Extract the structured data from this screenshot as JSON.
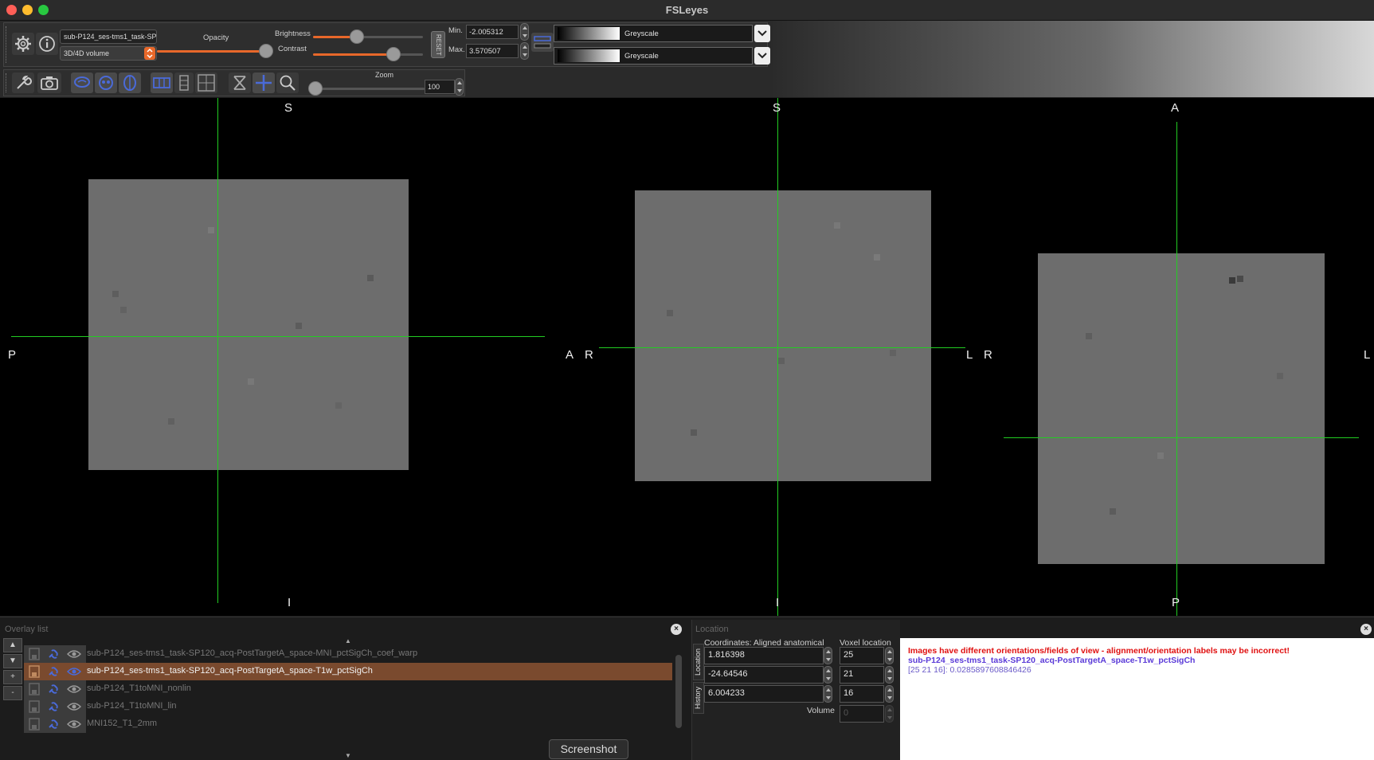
{
  "window": {
    "title": "FSLeyes"
  },
  "overlay_toolbar": {
    "overlay_name": "sub-P124_ses-tms1_task-SP",
    "overlay_type": "3D/4D volume",
    "opacity_label": "Opacity",
    "opacity_value": 0.98,
    "brightness_label": "Brightness",
    "brightness_value": 0.4,
    "contrast_label": "Contrast",
    "contrast_value": 0.73,
    "reset_label": "RESET",
    "min_label": "Min.",
    "min_value": "-2.005312",
    "max_label": "Max.",
    "max_value": "3.570507",
    "cmap1_name": "Greyscale",
    "cmap2_name": "Greyscale"
  },
  "ortho_toolbar": {
    "zoom_label": "Zoom",
    "zoom_value": "100"
  },
  "canvases": [
    {
      "top": "S",
      "bottom": "I",
      "left": "P",
      "right": "A"
    },
    {
      "top": "S",
      "bottom": "I",
      "left": "R",
      "right": "L"
    },
    {
      "top": "A",
      "bottom": "P",
      "left": "R",
      "right": "L"
    }
  ],
  "overlay_list": {
    "title": "Overlay list",
    "controls": [
      "▲",
      "▼",
      "+",
      "-"
    ],
    "items": [
      {
        "name": "sub-P124_ses-tms1_task-SP120_acq-PostTargetA_space-MNI_pctSigCh_coef_warp",
        "selected": false
      },
      {
        "name": "sub-P124_ses-tms1_task-SP120_acq-PostTargetA_space-T1w_pctSigCh",
        "selected": true
      },
      {
        "name": "sub-P124_T1toMNI_nonlin",
        "selected": false
      },
      {
        "name": "sub-P124_T1toMNI_lin",
        "selected": false
      },
      {
        "name": "MNI152_T1_2mm",
        "selected": false
      }
    ],
    "screenshot_label": "Screenshot"
  },
  "location_panel": {
    "title": "Location",
    "tab_location": "Location",
    "tab_history": "History",
    "coords_label": "Coordinates: Aligned anatomical",
    "voxel_label": "Voxel location",
    "coords": [
      "1.816398",
      "-24.64546",
      "6.004233"
    ],
    "voxels": [
      "25",
      "21",
      "16"
    ],
    "volume_label": "Volume",
    "volume_value": "0"
  },
  "info": {
    "warning": "Images have different orientations/fields of view - alignment/orientation labels may be incorrect!",
    "overlay": "sub-P124_ses-tms1_task-SP120_acq-PostTargetA_space-T1w_pctSigCh",
    "value": "[25 21 16]: 0.0285897608846426"
  },
  "colors": {
    "accent": "#e8682a",
    "cursor": "#22cc22",
    "selected_row": "#7a4a2e"
  }
}
